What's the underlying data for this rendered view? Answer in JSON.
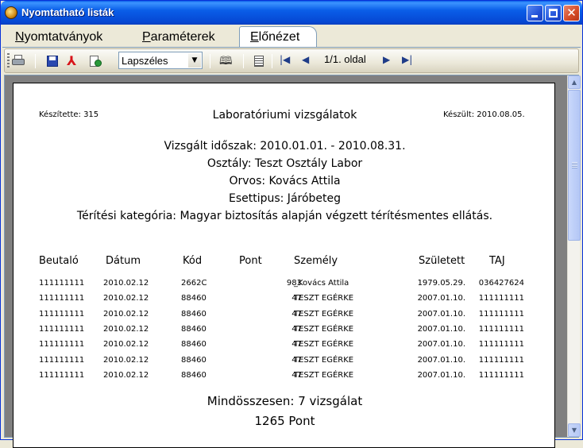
{
  "window": {
    "title": "Nyomtatható listák",
    "close_glyph": "✕"
  },
  "tabs": [
    {
      "underline": "N",
      "rest": "yomtatványok"
    },
    {
      "underline": "P",
      "rest": "araméterek"
    },
    {
      "underline": "E",
      "rest": "lőnézet"
    }
  ],
  "toolbar": {
    "zoom_value": "Lapszéles",
    "page_info": "1/1. oldal",
    "icons": [
      "printer-icon",
      "save-icon",
      "pdf-icon",
      "export-icon",
      "book-icon",
      "pages-icon",
      "first-page-icon",
      "prev-page-icon",
      "next-page-icon",
      "last-page-icon"
    ]
  },
  "report": {
    "made_by": "Készítette: 315",
    "title": "Laboratóriumi vizsgálatok",
    "made_on": "Készült: 2010.08.05.",
    "period": "Vizsgált időszak: 2010.01.01. - 2010.08.31.",
    "department": "Osztály: Teszt Osztály Labor",
    "doctor": "Orvos: Kovács Attila",
    "case_type": "Esettipus: Járóbeteg",
    "category": "Térítési kategória: Magyar biztosítás alapján végzett térítésmentes ellátás.",
    "columns": [
      "Beutaló",
      "Dátum",
      "Kód",
      "Pont",
      "Személy",
      "Született",
      "TAJ"
    ],
    "rows": [
      [
        "111111111",
        "2010.02.12",
        "2662C",
        "983",
        "_Kovács Attila",
        "1979.05.29.",
        "036427624"
      ],
      [
        "111111111",
        "2010.02.12",
        "88460",
        "47",
        "TESZT EGÉRKE",
        "2007.01.10.",
        "111111111"
      ],
      [
        "111111111",
        "2010.02.12",
        "88460",
        "47",
        "TESZT EGÉRKE",
        "2007.01.10.",
        "111111111"
      ],
      [
        "111111111",
        "2010.02.12",
        "88460",
        "47",
        "TESZT EGÉRKE",
        "2007.01.10.",
        "111111111"
      ],
      [
        "111111111",
        "2010.02.12",
        "88460",
        "47",
        "TESZT EGÉRKE",
        "2007.01.10.",
        "111111111"
      ],
      [
        "111111111",
        "2010.02.12",
        "88460",
        "47",
        "TESZT EGÉRKE",
        "2007.01.10.",
        "111111111"
      ],
      [
        "111111111",
        "2010.02.12",
        "88460",
        "47",
        "TESZT EGÉRKE",
        "2007.01.10.",
        "111111111"
      ]
    ],
    "total_count": "Mindösszesen: 7 vizsgálat",
    "total_points": "1265 Pont"
  }
}
